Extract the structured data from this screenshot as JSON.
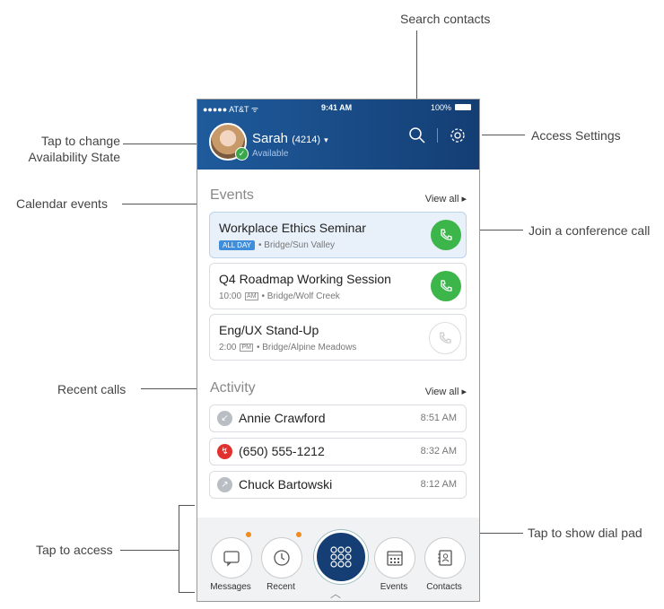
{
  "annotations": {
    "search": "Search contacts",
    "settings": "Access Settings",
    "availability_1": "Tap to change",
    "availability_2": "Availability State",
    "calendar": "Calendar events",
    "conference": "Join a conference call",
    "recent": "Recent calls",
    "dialpad": "Tap to show dial pad",
    "access": "Tap to access"
  },
  "status_bar": {
    "carrier": "●●●●● AT&T ᯤ",
    "time": "9:41 AM",
    "battery": "100%"
  },
  "user": {
    "name": "Sarah",
    "ext": "(4214)",
    "state": "Available"
  },
  "events": {
    "title": "Events",
    "view_all": "View all ▸",
    "items": [
      {
        "title": "Workplace Ethics Seminar",
        "tag": "ALL DAY",
        "time": "",
        "ampm": "",
        "location": "• Bridge/Sun Valley"
      },
      {
        "title": "Q4 Roadmap Working Session",
        "tag": "",
        "time": "10:00",
        "ampm": "AM",
        "location": "• Bridge/Wolf Creek"
      },
      {
        "title": "Eng/UX Stand-Up",
        "tag": "",
        "time": "2:00",
        "ampm": "PM",
        "location": "• Bridge/Alpine Meadows"
      }
    ]
  },
  "activity": {
    "title": "Activity",
    "view_all": "View all ▸",
    "items": [
      {
        "name": "Annie Crawford",
        "time": "8:51 AM",
        "icon": "↙"
      },
      {
        "name": "(650) 555-1212",
        "time": "8:32 AM",
        "icon": "↯"
      },
      {
        "name": "Chuck Bartowski",
        "time": "8:12 AM",
        "icon": "↗"
      }
    ]
  },
  "nav": {
    "messages": "Messages",
    "recent": "Recent",
    "events": "Events",
    "contacts": "Contacts"
  }
}
